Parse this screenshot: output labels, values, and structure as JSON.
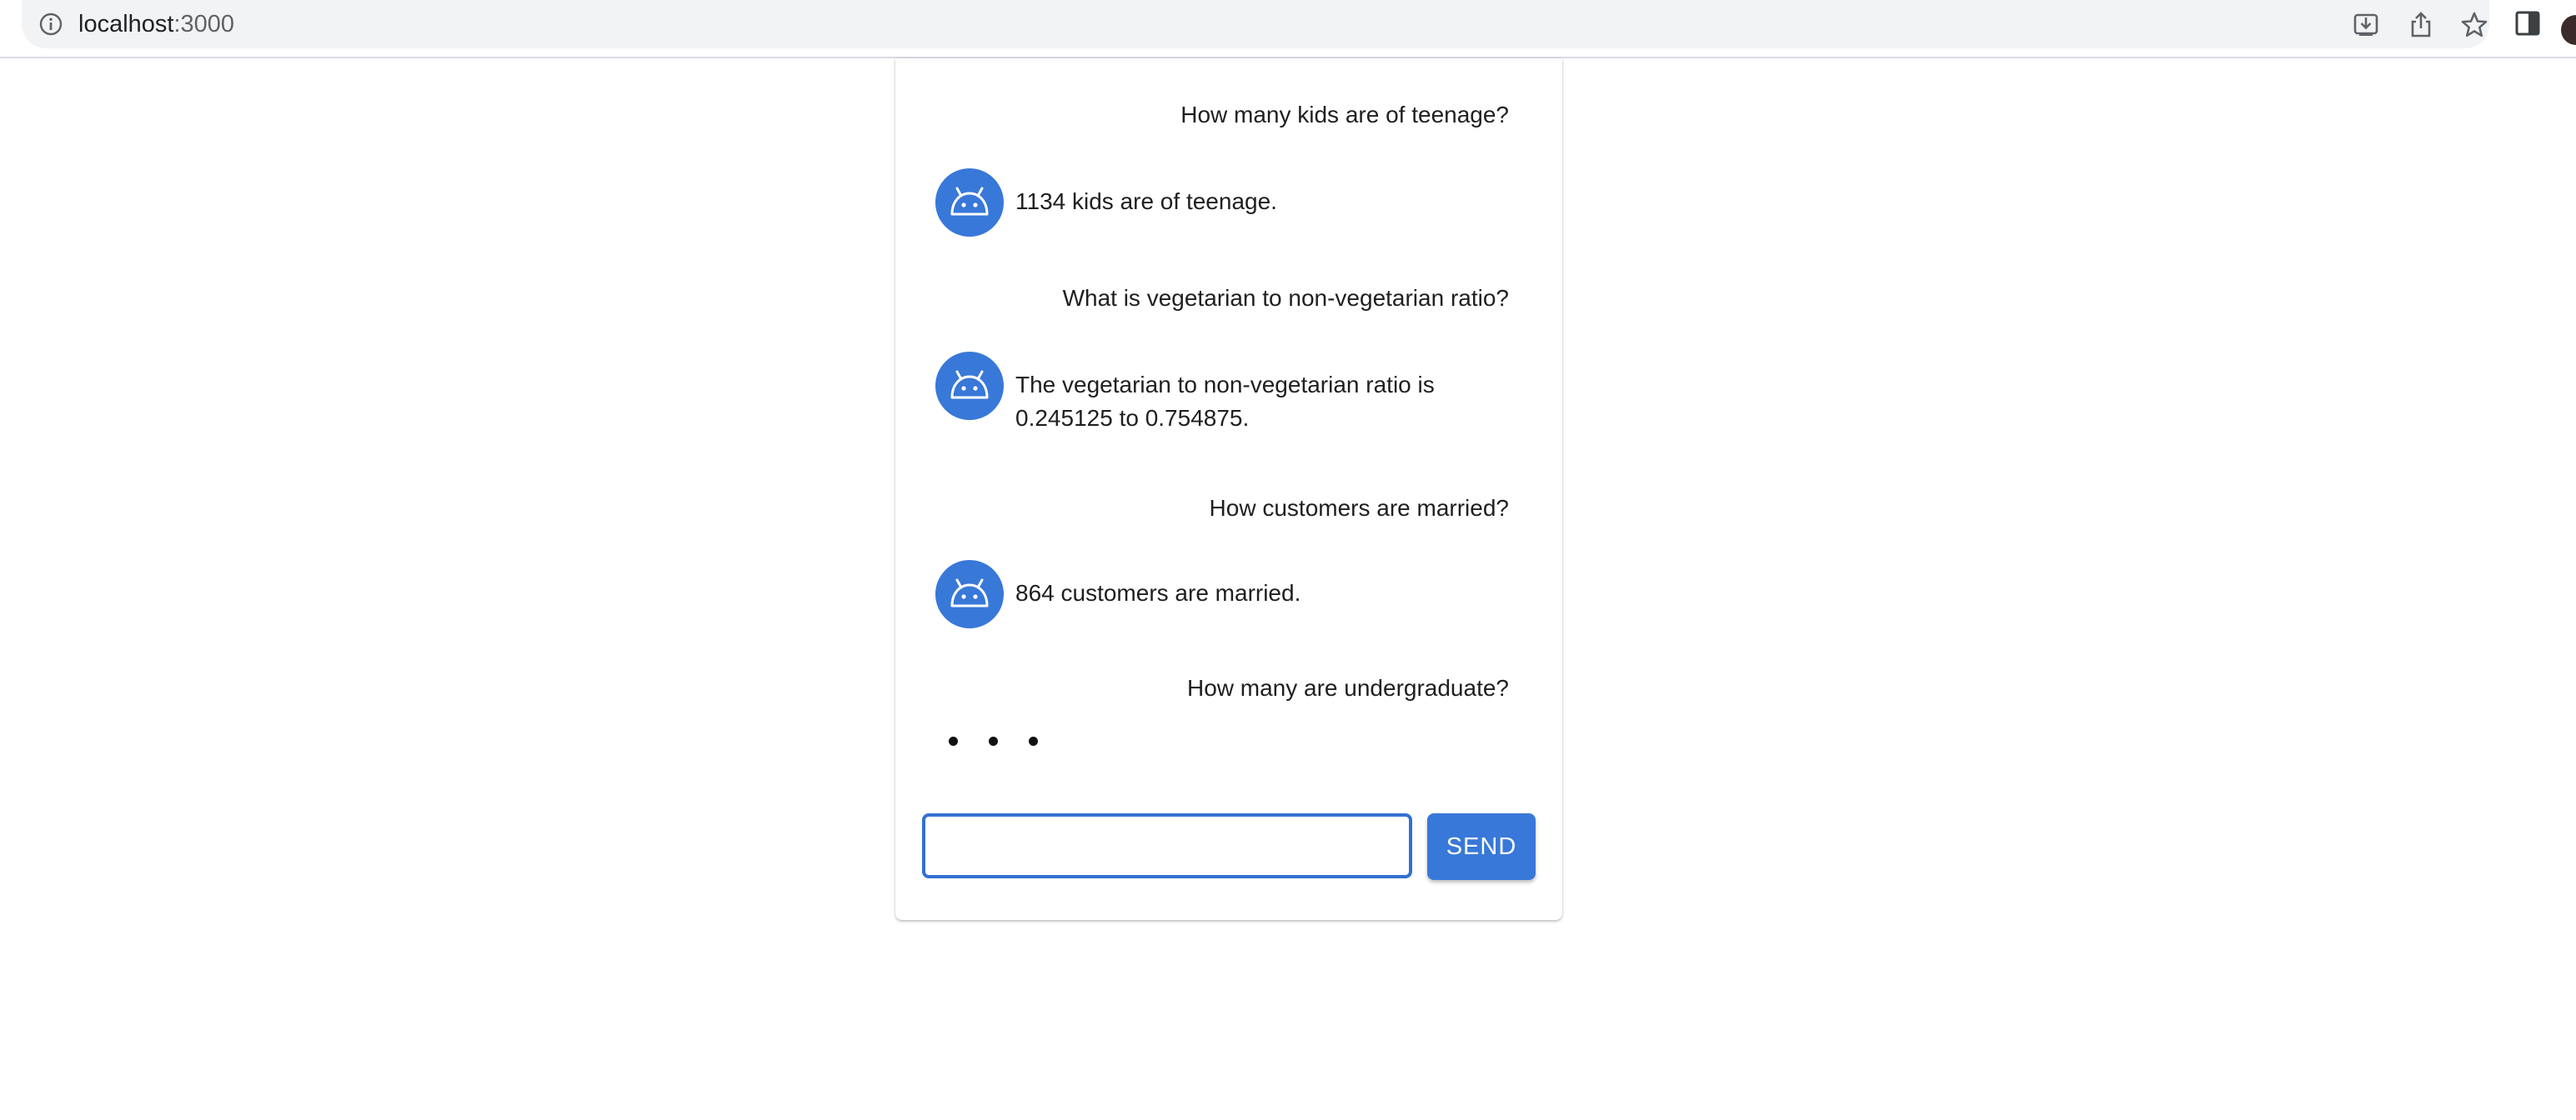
{
  "browser": {
    "url_host": "localhost",
    "url_port": ":3000"
  },
  "chat": {
    "messages": [
      {
        "role": "user",
        "text": "How many kids are of teenage?"
      },
      {
        "role": "bot",
        "text": "1134 kids are of teenage."
      },
      {
        "role": "user",
        "text": "What is vegetarian to non-vegetarian ratio?"
      },
      {
        "role": "bot",
        "text": "The vegetarian to non-vegetarian ratio is 0.245125 to 0.754875."
      },
      {
        "role": "user",
        "text": "How customers are married?"
      },
      {
        "role": "bot",
        "text": "864 customers are married."
      },
      {
        "role": "user",
        "text": "How many are undergraduate?"
      }
    ],
    "input": {
      "value": "",
      "placeholder": ""
    },
    "send_label": "SEND"
  },
  "colors": {
    "accent": "#3878d8",
    "input_border": "#3371cf"
  },
  "icons": {
    "bot_avatar": "android-icon"
  }
}
